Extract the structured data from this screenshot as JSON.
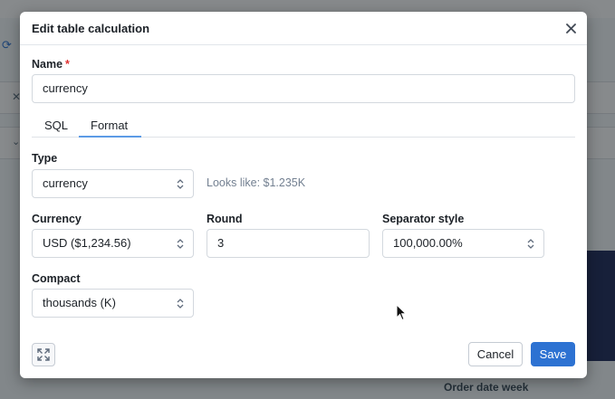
{
  "background": {
    "axis_label": "Order date week"
  },
  "dialog": {
    "title": "Edit table calculation",
    "name_label": "Name",
    "required_mark": "*",
    "name_value": "currency",
    "tabs": [
      {
        "label": "SQL",
        "active": false
      },
      {
        "label": "Format",
        "active": true
      }
    ],
    "type": {
      "label": "Type",
      "value": "currency",
      "hint": "Looks like: $1.235K"
    },
    "currency": {
      "label": "Currency",
      "value": "USD ($1,234.56)"
    },
    "round": {
      "label": "Round",
      "value": "3"
    },
    "separator": {
      "label": "Separator style",
      "value": "100,000.00%"
    },
    "compact": {
      "label": "Compact",
      "value": "thousands (K)"
    },
    "buttons": {
      "cancel": "Cancel",
      "save": "Save"
    }
  },
  "colors": {
    "primary": "#2d72d2",
    "required": "#e03131",
    "tab_underline": "#5c9be6"
  },
  "icons": [
    "close-icon",
    "expand-icon",
    "caret-updown-icon",
    "refresh-icon",
    "mouse-cursor-icon"
  ]
}
